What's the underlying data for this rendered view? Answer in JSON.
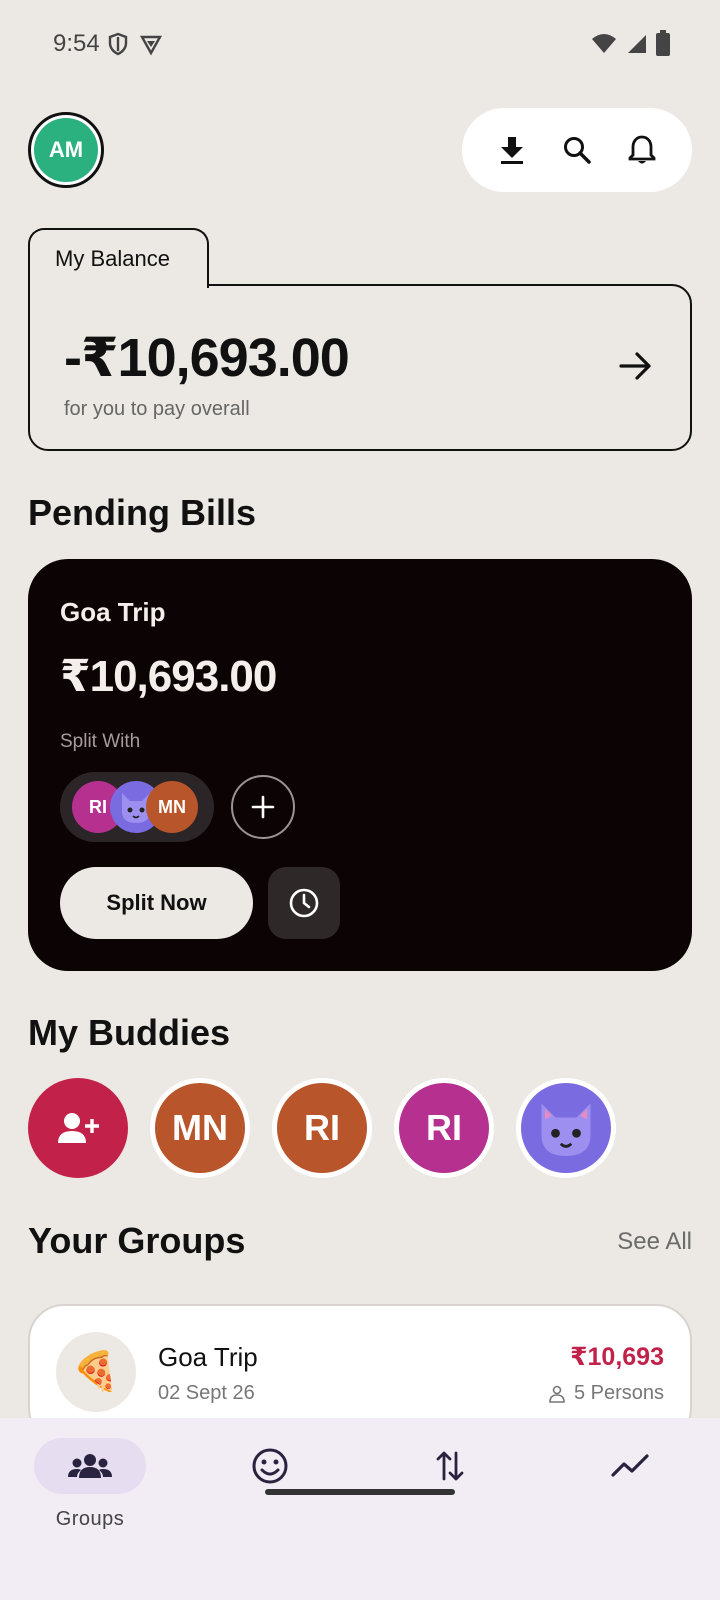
{
  "status": {
    "time": "9:54"
  },
  "header": {
    "avatar_initials": "AM",
    "avatar_color": "#2BB07F"
  },
  "balance": {
    "tab_label": "My Balance",
    "amount": "-₹10,693.00",
    "subtitle": "for you to pay overall"
  },
  "pending": {
    "title": "Pending Bills",
    "bill_name": "Goa Trip",
    "bill_amount": "₹10,693.00",
    "split_label": "Split With",
    "split_members": [
      "RI",
      "MN"
    ],
    "split_now_label": "Split Now"
  },
  "buddies": {
    "title": "My Buddies",
    "items": [
      "MN",
      "RI",
      "RI"
    ]
  },
  "groups": {
    "title": "Your Groups",
    "see_all": "See All",
    "items": [
      {
        "emoji": "🍕",
        "name": "Goa Trip",
        "date": "02 Sept 26",
        "amount": "₹10,693",
        "persons": "5 Persons"
      }
    ]
  },
  "nav": {
    "groups_label": "Groups"
  },
  "colors": {
    "accent_red": "#C2224A",
    "orange": "#B9552A",
    "magenta": "#B6308F",
    "purple": "#7B6BE0",
    "dark_card": "#0C0305"
  }
}
